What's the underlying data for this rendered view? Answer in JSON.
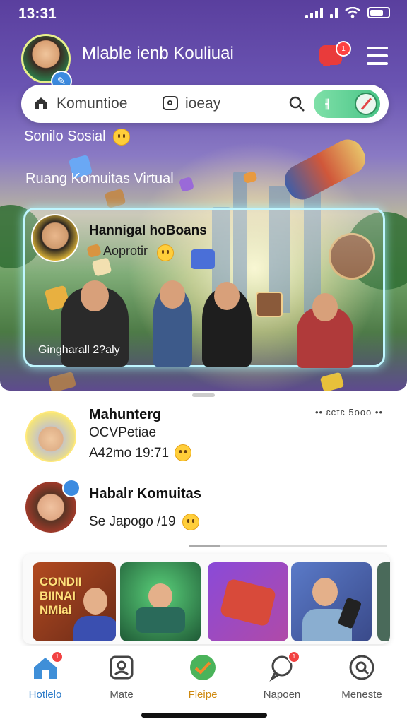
{
  "status_bar": {
    "time": "13:31"
  },
  "header": {
    "title": "Mlable ienb Kouliuai",
    "notification_count": "1"
  },
  "search": {
    "placeholder": "Komuntioe",
    "suffix": "ioeay",
    "filter_glyph": "⫲"
  },
  "hero": {
    "social_label": "Sonilo Sosial",
    "section_title": "Ruang Komuitas Virtual",
    "featured": {
      "title": "Hannigal hoBoans",
      "subtitle": "Aoprotir",
      "footer": "Gingharall 2?aly"
    }
  },
  "chats": [
    {
      "name": "Mahunterg",
      "line1": "OCVPetiae",
      "line2": "A42mo 19:71",
      "meta": "•• ɛᴄɪɛ 5ooo ••"
    },
    {
      "name": "Habalr Komuitas",
      "line1": "Se Japogo /19"
    }
  ],
  "gallery": {
    "first_tile_text": [
      "CONDII",
      "BIINAI",
      "NMiai"
    ]
  },
  "tabs": [
    {
      "label": "Hotlelo",
      "icon": "home-icon",
      "badge": "1",
      "active": true
    },
    {
      "label": "Mate",
      "icon": "profile-card-icon"
    },
    {
      "label": "Fleipe",
      "icon": "check-circle-icon"
    },
    {
      "label": "Napoen",
      "icon": "chat-bubble-icon",
      "badge": "1"
    },
    {
      "label": "Meneste",
      "icon": "search-circle-icon"
    }
  ],
  "colors": {
    "accent_blue": "#2e7cc8",
    "accent_green": "#49c487",
    "badge_red": "#f24242",
    "hero_purple": "#5a3f9e"
  }
}
